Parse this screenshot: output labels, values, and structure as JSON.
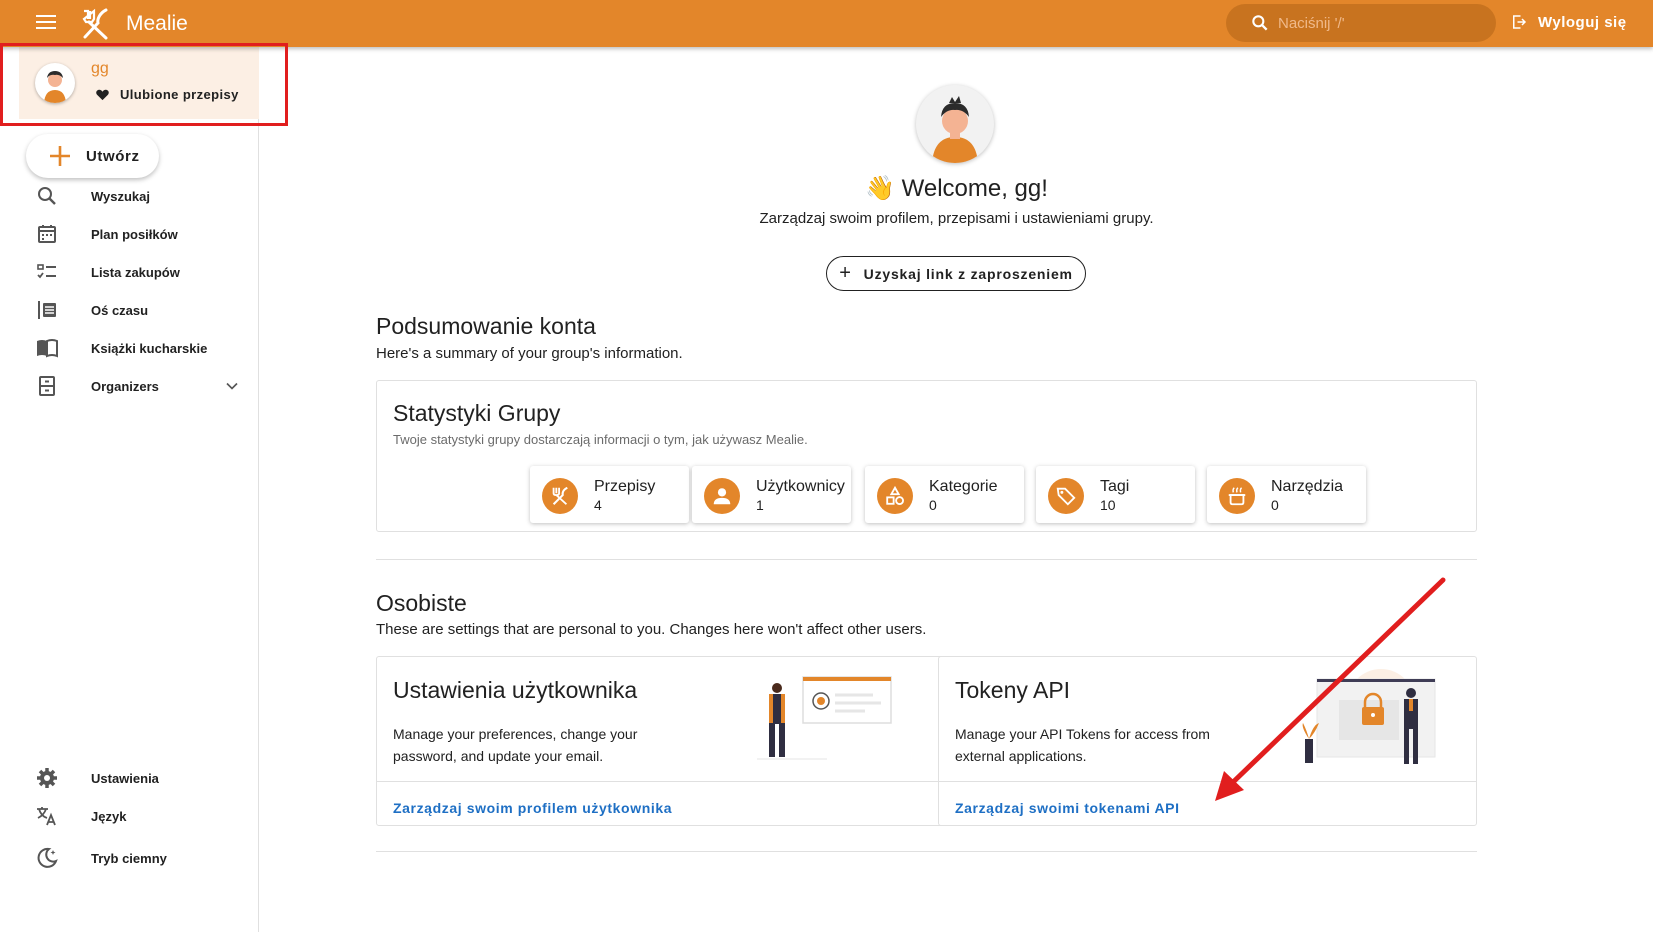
{
  "appbar": {
    "title": "Mealie",
    "search_placeholder": "Naciśnij '/'",
    "logout_label": "Wyloguj się",
    "accent_color": "#e3862a"
  },
  "sidebar": {
    "user": {
      "name": "gg",
      "favorites_label": "Ulubione przepisy"
    },
    "create_label": "Utwórz",
    "items": [
      {
        "label": "Wyszukaj",
        "icon": "search-icon"
      },
      {
        "label": "Plan posiłków",
        "icon": "calendar-icon"
      },
      {
        "label": "Lista zakupów",
        "icon": "checklist-icon"
      },
      {
        "label": "Oś czasu",
        "icon": "timeline-icon"
      },
      {
        "label": "Książki kucharskie",
        "icon": "book-icon"
      },
      {
        "label": "Organizers",
        "icon": "cabinet-icon"
      }
    ],
    "bottom_items": [
      {
        "label": "Ustawienia",
        "icon": "gear-icon"
      },
      {
        "label": "Język",
        "icon": "translate-icon"
      },
      {
        "label": "Tryb ciemny",
        "icon": "moon-icon"
      }
    ]
  },
  "main": {
    "welcome_emoji": "👋",
    "welcome": "Welcome, gg!",
    "welcome_sub": "Zarządzaj swoim profilem, przepisami i ustawieniami grupy.",
    "invite_label": "Uzyskaj link z zaproszeniem",
    "account": {
      "title": "Podsumowanie konta",
      "subtitle": "Here's a summary of your group's information.",
      "stats_title": "Statystyki Grupy",
      "stats_subtitle": "Twoje statystyki grupy dostarczają informacji o tym, jak używasz Mealie.",
      "stats": [
        {
          "label": "Przepisy",
          "count": "4",
          "icon": "fork-knife-icon"
        },
        {
          "label": "Użytkownicy",
          "count": "1",
          "icon": "person-icon"
        },
        {
          "label": "Kategorie",
          "count": "0",
          "icon": "shapes-icon"
        },
        {
          "label": "Tagi",
          "count": "10",
          "icon": "tags-icon"
        },
        {
          "label": "Narzędzia",
          "count": "0",
          "icon": "pot-icon"
        }
      ]
    },
    "personal": {
      "title": "Osobiste",
      "subtitle": "These are settings that are personal to you. Changes here won't affect other users.",
      "cards": [
        {
          "title": "Ustawienia użytkownika",
          "description": "Manage your preferences, change your password, and update your email.",
          "link": "Zarządzaj swoim profilem użytkownika"
        },
        {
          "title": "Tokeny API",
          "description": "Manage your API Tokens for access from external applications.",
          "link": "Zarządzaj swoimi tokenami API"
        }
      ]
    }
  }
}
